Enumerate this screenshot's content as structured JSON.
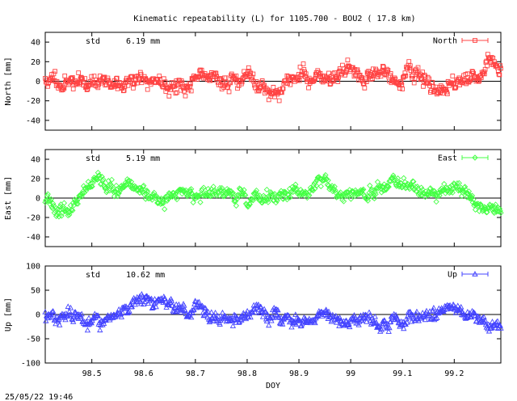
{
  "title": "Kinematic repeatability (L) for 1105.700 - BOU2  ( 17.8 km)",
  "footer_timestamp": "25/05/22 19:46",
  "chart_data": [
    {
      "type": "scatter",
      "series": [
        {
          "name": "North",
          "color": "#ff4444",
          "marker": "square",
          "std": 6.19,
          "amplitude": 6.19,
          "seed": 11
        }
      ],
      "ylabel": "North [mm]",
      "ylim": [
        -50,
        50
      ],
      "yticks": [
        -40,
        -20,
        0,
        20,
        40
      ],
      "std_label": "std",
      "std_value": "6.19 mm",
      "legend": "top-right",
      "xlim": [
        98.41,
        99.29
      ]
    },
    {
      "type": "scatter",
      "series": [
        {
          "name": "East",
          "color": "#44ff44",
          "marker": "diamond",
          "std": 5.19,
          "amplitude": 5.19,
          "seed": 23
        }
      ],
      "ylabel": "East [mm]",
      "ylim": [
        -50,
        50
      ],
      "yticks": [
        -40,
        -20,
        0,
        20,
        40
      ],
      "std_label": "std",
      "std_value": "5.19 mm",
      "legend": "top-right",
      "xlim": [
        98.41,
        99.29
      ]
    },
    {
      "type": "scatter",
      "series": [
        {
          "name": "Up",
          "color": "#4444ff",
          "marker": "triangle",
          "std": 10.62,
          "amplitude": 10.62,
          "seed": 37
        }
      ],
      "ylabel": "Up [mm]",
      "ylim": [
        -100,
        100
      ],
      "yticks": [
        -100,
        -50,
        0,
        50,
        100
      ],
      "std_label": "std",
      "std_value": "10.62 mm",
      "legend": "top-right",
      "xlim": [
        98.41,
        99.29
      ],
      "xlabel": "DOY",
      "xticks": [
        98.5,
        98.6,
        98.7,
        98.8,
        98.9,
        99,
        99.1,
        99.2
      ]
    }
  ]
}
